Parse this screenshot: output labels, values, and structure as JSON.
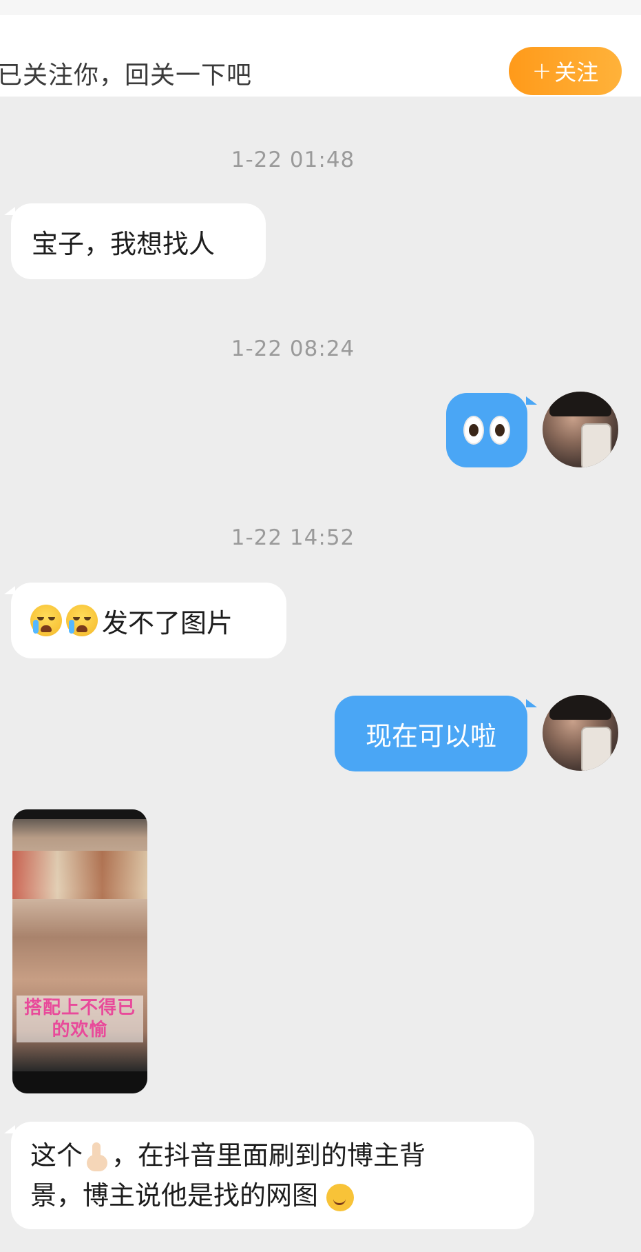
{
  "follow_bar": {
    "text": "已关注你，回关一下吧",
    "button_plus": "+",
    "button_label": "关注",
    "button_color": "#ff9f22"
  },
  "messages": [
    {
      "type": "timestamp",
      "text": "1-22 01:48"
    },
    {
      "type": "text",
      "side": "left",
      "text": "宝子，我想找人"
    },
    {
      "type": "timestamp",
      "text": "1-22 08:24"
    },
    {
      "type": "emoji",
      "side": "right",
      "emoji": "eyes-emoji"
    },
    {
      "type": "timestamp",
      "text": "1-22 14:52"
    },
    {
      "type": "text",
      "side": "left",
      "text": "发不了图片",
      "prefix_emojis": [
        "crying-face-emoji",
        "crying-face-emoji"
      ]
    },
    {
      "type": "text",
      "side": "right",
      "text": "现在可以啦"
    },
    {
      "type": "image",
      "side": "left",
      "caption": "搭配上不得已的欢愉"
    },
    {
      "type": "text",
      "side": "left",
      "line1_a": "这个",
      "line1_b": "，在抖音里面刷到的博主背",
      "line2": "景，博主说他是找的网图"
    }
  ],
  "colors": {
    "background": "#ededed",
    "left_bubble": "#ffffff",
    "right_bubble": "#4aa6f5",
    "timestamp": "#9a9a9a"
  }
}
